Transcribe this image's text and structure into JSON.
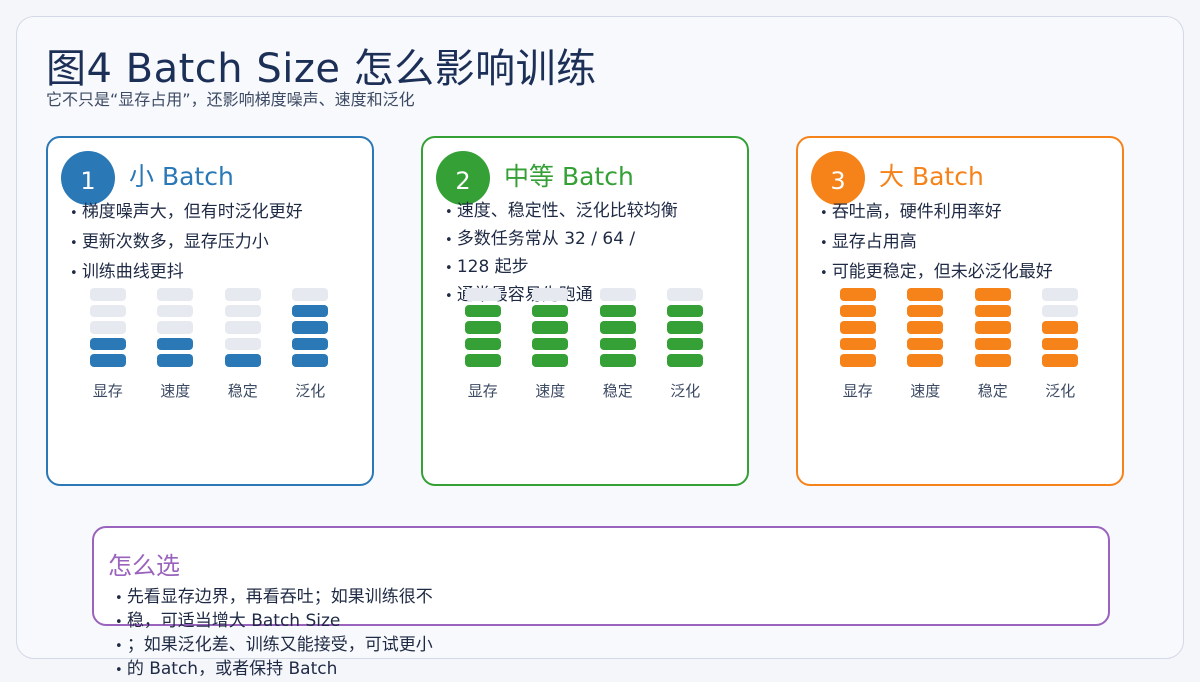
{
  "header": {
    "title": "图4  Batch Size 怎么影响训练",
    "subtitle": "它不只是“显存占用”，还影响梯度噪声、速度和泛化"
  },
  "metric_labels": [
    "显存",
    "速度",
    "稳定",
    "泛化"
  ],
  "colors": {
    "small": "#2a78b6",
    "medium": "#34a035",
    "large": "#f6821a",
    "panel": "#9a63bd",
    "inactive_segment": "#e6eaf0"
  },
  "cards": [
    {
      "number": "1",
      "title": "小 Batch",
      "bullets": [
        "梯度噪声大，但有时泛化更好",
        "更新次数多，显存压力小",
        "训练曲线更抖"
      ]
    },
    {
      "number": "2",
      "title": "中等 Batch",
      "bullets": [
        "速度、稳定性、泛化比较均衡",
        "多数任务常从 32 / 64 /",
        "128 起步",
        "通常最容易先跑通"
      ]
    },
    {
      "number": "3",
      "title": "大 Batch",
      "bullets": [
        "吞吐高，硬件利用率好",
        "显存占用高",
        "可能更稳定，但未必泛化最好"
      ]
    }
  ],
  "chart_data": [
    {
      "type": "bar",
      "categories": [
        "显存",
        "速度",
        "稳定",
        "泛化"
      ],
      "values": [
        2,
        2,
        1,
        4
      ],
      "ylim": [
        0,
        5
      ]
    },
    {
      "type": "bar",
      "categories": [
        "显存",
        "速度",
        "稳定",
        "泛化"
      ],
      "values": [
        4,
        4,
        4,
        4
      ],
      "ylim": [
        0,
        5
      ]
    },
    {
      "type": "bar",
      "categories": [
        "显存",
        "速度",
        "稳定",
        "泛化"
      ],
      "values": [
        5,
        5,
        5,
        3
      ],
      "ylim": [
        0,
        5
      ]
    }
  ],
  "panel": {
    "title": "怎么选",
    "lines": [
      "先看显存边界，再看吞吐；如果训练很不",
      "稳，可适当增大 Batch Size",
      "；如果泛化差、训练又能接受，可试更小",
      "的 Batch，或者保持 Batch"
    ]
  }
}
